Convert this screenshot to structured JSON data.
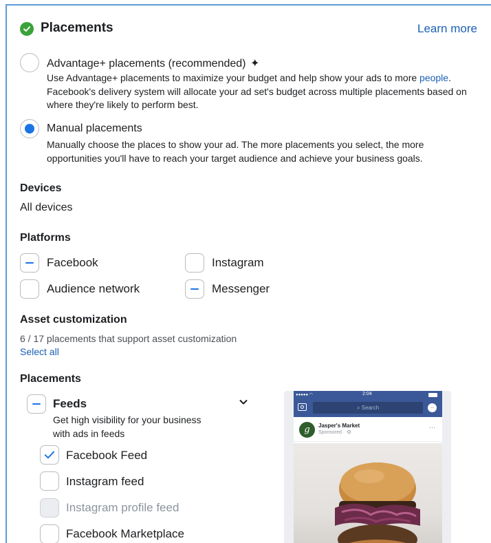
{
  "header": {
    "title": "Placements",
    "learn_more": "Learn more"
  },
  "options": {
    "advantage": {
      "title": "Advantage+ placements (recommended)",
      "sparkle": "✦",
      "desc_before": "Use Advantage+ placements to maximize your budget and help show your ads to more ",
      "desc_link": "people",
      "desc_after": ". Facebook's delivery system will allocate your ad set's budget across multiple placements based on where they're likely to perform best.",
      "selected": false
    },
    "manual": {
      "title": "Manual placements",
      "desc": "Manually choose the places to show your ad. The more placements you select, the more opportunities you'll have to reach your target audience and achieve your business goals.",
      "selected": true
    }
  },
  "devices": {
    "label": "Devices",
    "value": "All devices"
  },
  "platforms": {
    "label": "Platforms",
    "items": [
      {
        "label": "Facebook",
        "state": "partial"
      },
      {
        "label": "Instagram",
        "state": "unchecked"
      },
      {
        "label": "Audience network",
        "state": "unchecked"
      },
      {
        "label": "Messenger",
        "state": "partial"
      }
    ]
  },
  "asset": {
    "label": "Asset customization",
    "count_text": "6 / 17 placements that support asset customization",
    "select_all": "Select all"
  },
  "placements": {
    "label": "Placements",
    "group": {
      "title": "Feeds",
      "desc": "Get high visibility for your business with ads in feeds",
      "state": "partial",
      "chevron": "⌄"
    },
    "items": [
      {
        "label": "Facebook Feed",
        "state": "checked"
      },
      {
        "label": "Instagram feed",
        "state": "unchecked"
      },
      {
        "label": "Instagram profile feed",
        "state": "disabled"
      },
      {
        "label": "Facebook Marketplace",
        "state": "unchecked"
      }
    ]
  },
  "preview": {
    "time": "2:04",
    "search": "Search",
    "business": "Jasper's Market",
    "sponsored": "Sponsored ·  ",
    "avatar_letter": "g",
    "more": "···"
  },
  "colors": {
    "accent": "#1b74e4",
    "success": "#3aa23a",
    "link": "#1a5fb4",
    "facebook_bar": "#3b5998"
  }
}
